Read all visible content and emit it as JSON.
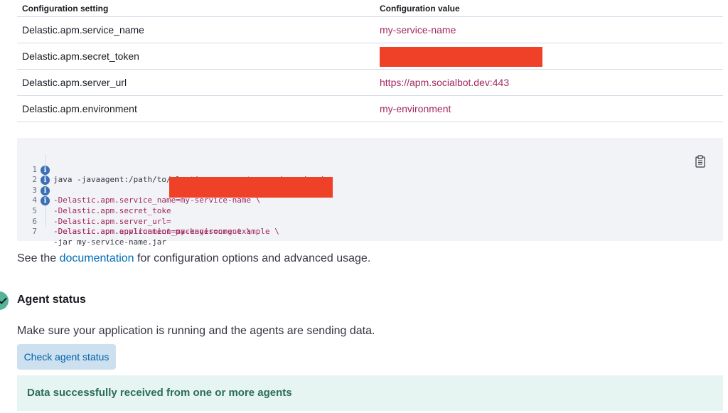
{
  "config_table": {
    "headers": {
      "setting": "Configuration setting",
      "value": "Configuration value"
    },
    "rows": [
      {
        "setting": "Delastic.apm.service_name",
        "value": "my-service-name",
        "redacted": false
      },
      {
        "setting": "Delastic.apm.secret_token",
        "value": "",
        "redacted": true
      },
      {
        "setting": "Delastic.apm.server_url",
        "value": "https://apm.socialbot.dev:443",
        "redacted": false
      },
      {
        "setting": "Delastic.apm.environment",
        "value": "my-environment",
        "redacted": false
      }
    ]
  },
  "code_block": {
    "lines": [
      {
        "num": "1",
        "info": false,
        "text": "java -javaagent:/path/to/elastic-apm-agent-<version>.jar \\"
      },
      {
        "num": "2",
        "info": true,
        "text": "-Delastic.apm.service_name=my-service-name \\"
      },
      {
        "num": "3",
        "info": true,
        "text": "-Delastic.apm.secret_toke"
      },
      {
        "num": "4",
        "info": true,
        "text": "-Delastic.apm.server_url="
      },
      {
        "num": "5",
        "info": true,
        "text": "-Delastic.apm.environment=my-environment \\"
      },
      {
        "num": "6",
        "info": false,
        "text": "-Delastic.apm.application_packages=org.example \\"
      },
      {
        "num": "7",
        "info": false,
        "text": "-jar my-service-name.jar"
      }
    ],
    "copy_icon": "copy-icon"
  },
  "docs": {
    "prefix": "See the ",
    "link": "documentation",
    "suffix": " for configuration options and advanced usage."
  },
  "agent_status": {
    "title": "Agent status",
    "description": "Make sure your application is running and the agents are sending data.",
    "button_label": "Check agent status",
    "success_message": "Data successfully received from one or more agents"
  },
  "colors": {
    "value_text": "#a2295f",
    "redaction": "#ef4127",
    "link": "#006bb8",
    "success_bg": "#e6f5f1",
    "success_text": "#2b6c5a",
    "button_bg": "#cce0f0",
    "step_marker": "#54b399"
  }
}
